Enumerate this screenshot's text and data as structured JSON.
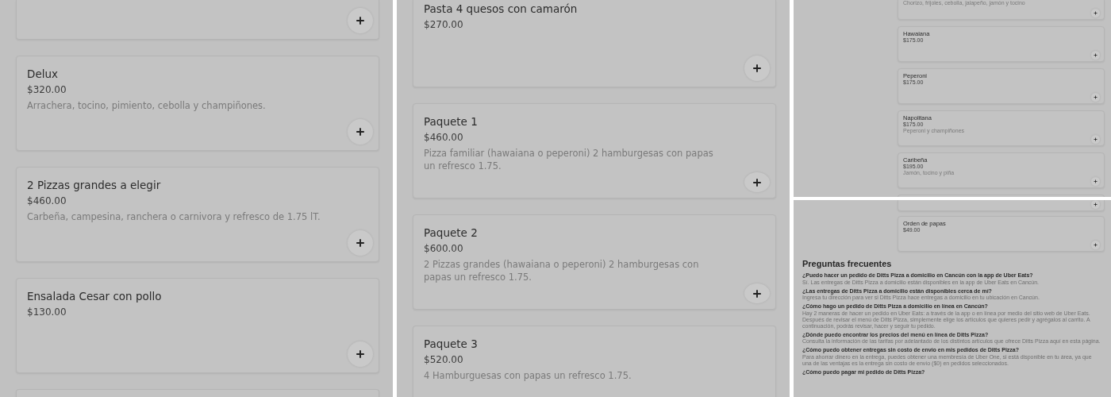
{
  "panels": [
    {
      "kind": "full",
      "items": [
        {
          "kind": "cut_top"
        },
        {
          "kind": "full",
          "title": "Delux",
          "price": "$320.00",
          "description": "Arrachera, tocino, pimiento, cebolla y champiñones."
        },
        {
          "kind": "full",
          "title": "2 Pizzas grandes a elegir",
          "price": "$460.00",
          "description": "Carbeña, campesina, ranchera o carnivora y refresco de 1.75 lT."
        },
        {
          "kind": "full",
          "title": "Ensalada Cesar con pollo",
          "price": "$130.00"
        },
        {
          "kind": "cut_bottom"
        }
      ]
    },
    {
      "kind": "full",
      "items": [
        {
          "kind": "cut_top",
          "title": "Pasta 4 quesos con camarón",
          "price": "$270.00"
        },
        {
          "kind": "full",
          "title": "Paquete 1",
          "price": "$460.00",
          "description": "Pizza familiar (hawaiana o peperoni) 2 hamburgesas con papas un refresco 1.75."
        },
        {
          "kind": "full",
          "title": "Paquete 2",
          "price": "$600.00",
          "description": "2 Pizzas grandes (hawaiana o peperoni) 2 hamburgesas con papas un refresco 1.75."
        },
        {
          "kind": "cut_bottom",
          "title": "Paquete 3",
          "price": "$520.00",
          "description": "4 Hamburguesas con papas un refresco 1.75."
        }
      ]
    },
    {
      "kind": "overview",
      "items": [
        {
          "kind": "cut_top",
          "description": "Chorizo, frijoles, cebolla, jalapeño, jamón y tocino"
        },
        {
          "kind": "full",
          "title": "Hawaiana",
          "price": "$175.00"
        },
        {
          "kind": "full",
          "title": "Peperoni",
          "price": "$175.00"
        },
        {
          "kind": "full",
          "title": "Napolitana",
          "price": "$175.00",
          "description": "Peperoni y champiñones"
        },
        {
          "kind": "full",
          "title": "Caribeña",
          "price": "$195.00",
          "description": "Jamón, tocino y piña"
        },
        {
          "kind": "cut_bottom"
        }
      ]
    },
    {
      "kind": "overview",
      "items": [
        {
          "kind": "cut_top"
        },
        {
          "kind": "full",
          "title": "Orden de papas",
          "price": "$49.00"
        }
      ],
      "faq": {
        "title": "Preguntas frecuentes",
        "entries": [
          {
            "question": "¿Puedo hacer un pedido de Ditts Pizza a domicilio en Cancún con la app de Uber Eats?",
            "answer": "Sí. Las entregas de Ditts Pizza a domicilio están disponibles en la app de Uber Eats en Cancún."
          },
          {
            "question": "¿Las entregas de Ditts Pizza a domicilio están disponibles cerca de mí?",
            "answer": "Ingresa tu dirección para ver si Ditts Pizza hace entregas a domicilio en tu ubicación en Cancún."
          },
          {
            "question": "¿Cómo hago un pedido de Ditts Pizza a domicilio en línea en Cancún?",
            "answer": "Hay 2 maneras de hacer un pedido en Uber Eats: a través de la app o en línea por medio del sitio web de Uber Eats. Después de revisar el menú de Ditts Pizza, simplemente elige los artículos que quieres pedir y agrégalos al carrito. A continuación, podrás revisar, hacer y seguir tu pedido."
          },
          {
            "question": "¿Dónde puedo encontrar los precios del menú en línea de Ditts Pizza?",
            "answer": "Consulta la información de las tarifas por adelantado de los distintos artículos que ofrece Ditts Pizza aquí en esta página."
          },
          {
            "question": "¿Cómo puedo obtener entregas sin costo de envío en mis pedidos de Ditts Pizza?",
            "answer": "Para ahorrar dinero en la entrega, puedes obtener una membresía de Uber One, si está disponible en tu área, ya que una de las ventajas es la entrega sin costo de envío ($0) en pedidos seleccionados."
          },
          {
            "question": "¿Cómo puedo pagar mi pedido de Ditts Pizza?"
          }
        ]
      }
    }
  ]
}
